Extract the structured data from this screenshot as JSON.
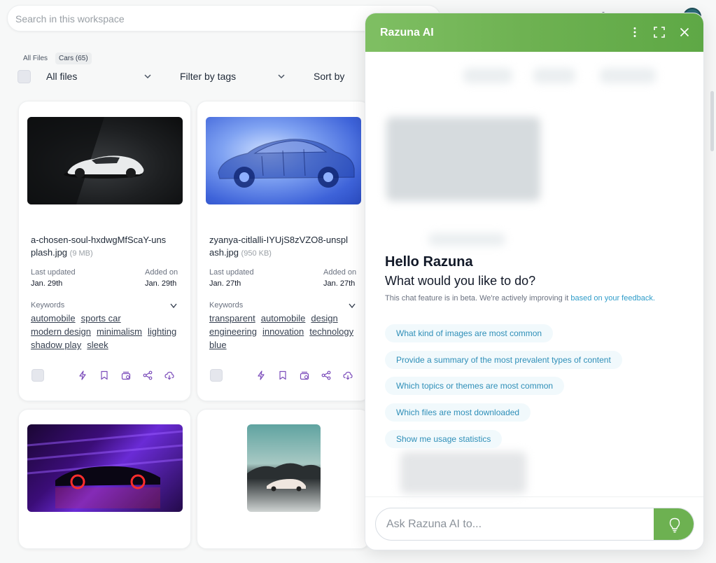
{
  "search": {
    "placeholder": "Search in this workspace"
  },
  "breadcrumb": [
    "All Files",
    "Cars (65)"
  ],
  "toolbar": {
    "files_label": "All files",
    "tags_label": "Filter by tags",
    "sort_label": "Sort by"
  },
  "labels": {
    "last_updated": "Last updated",
    "added_on": "Added on",
    "keywords": "Keywords"
  },
  "cards": [
    {
      "filename": "a-chosen-soul-hxdwgMfScaY-unsplash.jpg",
      "size": "(9 MB)",
      "last_updated": "Jan. 29th",
      "added_on": "Jan. 29th",
      "keywords": [
        "automobile",
        "sports car",
        "modern design",
        "minimalism",
        "lighting",
        "shadow play",
        "sleek"
      ]
    },
    {
      "filename": "zyanya-citlalli-IYUjS8zVZO8-unsplash.jpg",
      "size": "(950 KB)",
      "last_updated": "Jan. 27th",
      "added_on": "Jan. 27th",
      "keywords": [
        "transparent",
        "automobile",
        "design",
        "engineering",
        "innovation",
        "technology",
        "blue"
      ]
    }
  ],
  "panel": {
    "title": "Razuna AI",
    "hello": "Hello Razuna",
    "question": "What would you like to do?",
    "beta_note": "This chat feature is in beta. We're actively improving it",
    "beta_link": "based on your feedback.",
    "suggestions": [
      "What kind of images are most common",
      "Provide a summary of the most prevalent types of content",
      "Which topics or themes are most common",
      "Which files are most downloaded",
      "Show me usage statistics"
    ],
    "input_placeholder": "Ask Razuna AI to..."
  },
  "colors": {
    "accent_green": "#6db151",
    "link_blue": "#2f9cc9",
    "suggestion_bg": "#f1f9fc"
  },
  "icons": [
    "chevron-down-icon",
    "lightning-icon",
    "bookmark-icon",
    "collection-icon",
    "share-icon",
    "download-cloud-icon",
    "more-vertical-icon",
    "expand-icon",
    "close-icon",
    "lightbulb-icon"
  ]
}
